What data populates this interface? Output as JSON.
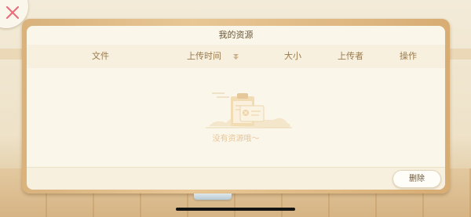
{
  "panel": {
    "title": "我的资源",
    "columns": {
      "file": "文件",
      "upload_time": "上传时间",
      "size": "大小",
      "uploader": "上传者",
      "actions": "操作"
    },
    "empty_text": "没有资源哦～",
    "delete_label": "删除"
  },
  "icons": {
    "close": "close-icon",
    "sort": "sort-desc-icon",
    "empty": "empty-clipboard-icon"
  },
  "colors": {
    "close": "#e8707a",
    "accent": "#e6c79a",
    "text": "#6b5532",
    "header_text": "#9a7a4c"
  }
}
